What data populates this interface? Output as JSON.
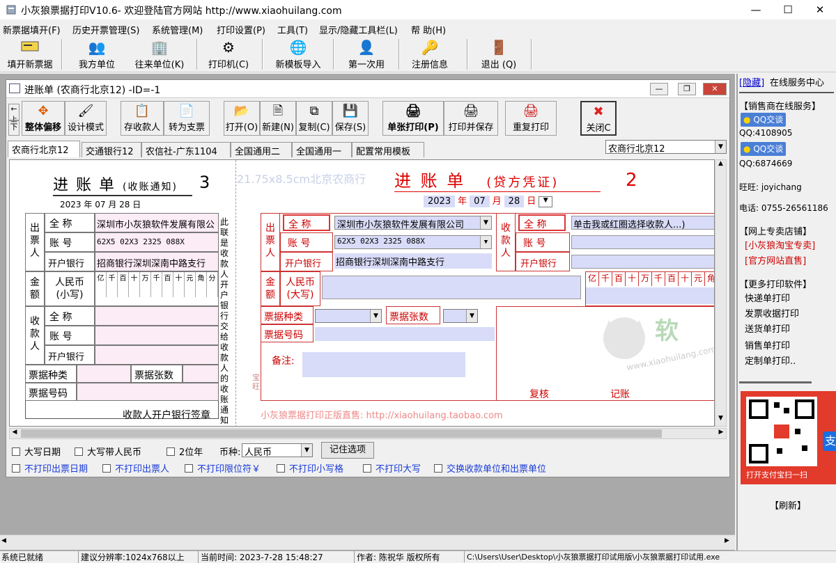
{
  "window": {
    "title": "小灰狼票据打印V10.6- 欢迎登陆官方网站 http://www.xiaohuilang.com"
  },
  "menu": [
    "新票据填开(F)",
    "历史开票管理(S)",
    "系统管理(M)",
    "打印设置(P)",
    "工具(T)",
    "显示/隐藏工具栏(L)",
    "帮 助(H)"
  ],
  "toolbar": [
    "填开新票据",
    "我方单位",
    "往来单位(K)",
    "打印机(C)",
    "新模板导入",
    "第一次用",
    "注册信息",
    "退出 (Q)"
  ],
  "child": {
    "title": "进账单 (农商行北京12) -ID=-1",
    "nav_up": "上",
    "nav_down": "下",
    "buttons": [
      "整体偏移",
      "设计模式",
      "存收款人",
      "转为支票",
      "打开(O)",
      "新建(N)",
      "复制(C)",
      "保存(S)",
      "单张打印(P)",
      "打印并保存",
      "重复打印",
      "关闭C"
    ],
    "tabs": [
      "农商行北京12",
      "交通银行12",
      "农信社-广东1104",
      "全国通用二",
      "全国通用一",
      "配置常用模板"
    ],
    "template_select": "农商行北京12"
  },
  "form_left": {
    "title": "进 账 单",
    "subtitle": "(收账通知)",
    "copy_no": "3",
    "year": "2023",
    "year_lbl": "年",
    "month": "07",
    "month_lbl": "月",
    "day": "28",
    "day_lbl": "日",
    "drawer": "出票人",
    "full_name": "全 称",
    "account": "账 号",
    "bank": "开户银行",
    "drawer_name": "深圳市小灰狼软件发展有限公",
    "drawer_account": "62X5 02X3 2325 088X",
    "drawer_bank": "招商银行深圳深南中路支行",
    "amount": "金额",
    "rmb": "人民币",
    "rmb2": "(小写)",
    "digits": [
      "亿",
      "千",
      "百",
      "十",
      "万",
      "千",
      "百",
      "十",
      "元",
      "角",
      "分"
    ],
    "payee": "收款人",
    "bill_type": "票据种类",
    "bill_count": "票据张数",
    "bill_no": "票据号码",
    "sign": "收款人开户银行签章",
    "side_note": "此联是收款人开户银行交给收款人的收账通知"
  },
  "form_right": {
    "watermark": "21.75x8.5cm北京农商行",
    "title": "进 账 单",
    "subtitle": "(贷方凭证)",
    "copy_no": "2",
    "year": "2023",
    "year_lbl": "年",
    "month": "07",
    "month_lbl": "月",
    "day": "28",
    "day_lbl": "日",
    "drawer": "出票人",
    "full_name": "全 称",
    "account": "账 号",
    "bank": "开户银行",
    "drawer_name": "深圳市小灰狼软件发展有限公司",
    "drawer_account": "62X5 02X3 2325 088X",
    "drawer_bank": "招商银行深圳深南中路支行",
    "payee": "收款人",
    "payee_hint": "单击我或红圈选择收款人...)",
    "amount": "金额",
    "rmb": "人民币",
    "rmb2": "(大写)",
    "digits": [
      "亿",
      "千",
      "百",
      "十",
      "万",
      "千",
      "百",
      "十",
      "元",
      "角"
    ],
    "bill_type": "票据种类",
    "bill_count": "票据张数",
    "bill_no": "票据号码",
    "remark": "备注:",
    "review": "复核",
    "bookkeep": "记账",
    "promo": "小灰狼票据打印正版直售: http://xiaohuilang.taobao.com",
    "brand_url": "www.xiaohuilang.com",
    "brand_char": "软",
    "side_mark": "宝旺"
  },
  "options": {
    "row1": [
      "大写日期",
      "大写带人民币",
      "2位年"
    ],
    "currency_lbl": "币种:",
    "currency": "人民币",
    "remember": "记住选项",
    "row2": [
      "不打印出票日期",
      "不打印出票人",
      "不打印限位符￥",
      "不打印小写格",
      "不打印大写",
      "交换收款单位和出票单位"
    ]
  },
  "side": {
    "hide": "[隐藏]",
    "center": "在线服务中心",
    "sales": "【销售商在线服务】",
    "qq_btn": "QQ交谈",
    "qq1": "QQ:4108905",
    "qq2": "QQ:6874669",
    "wangwang": "旺旺: joyichang",
    "phone": "电话: 0755-26561186",
    "store": "【网上专卖店铺】",
    "taobao": "[小灰狼淘宝专卖]",
    "official": "[官方网站直售]",
    "more": "【更多打印软件】",
    "soft": [
      "快递单打印",
      "发票收据打印",
      "送货单打印",
      "销售单打印",
      "定制单打印.."
    ],
    "scan": "打开支付宝扫一扫",
    "refresh": "【刷新】"
  },
  "status": [
    "系统已就绪",
    "建议分辨率:1024x768以上",
    "当前时间: 2023-7-28 15:48:27",
    "作者: 陈祝华 版权所有",
    "C:\\Users\\User\\Desktop\\小灰狼票据打印试用版\\小灰狼票据打印试用.exe"
  ]
}
